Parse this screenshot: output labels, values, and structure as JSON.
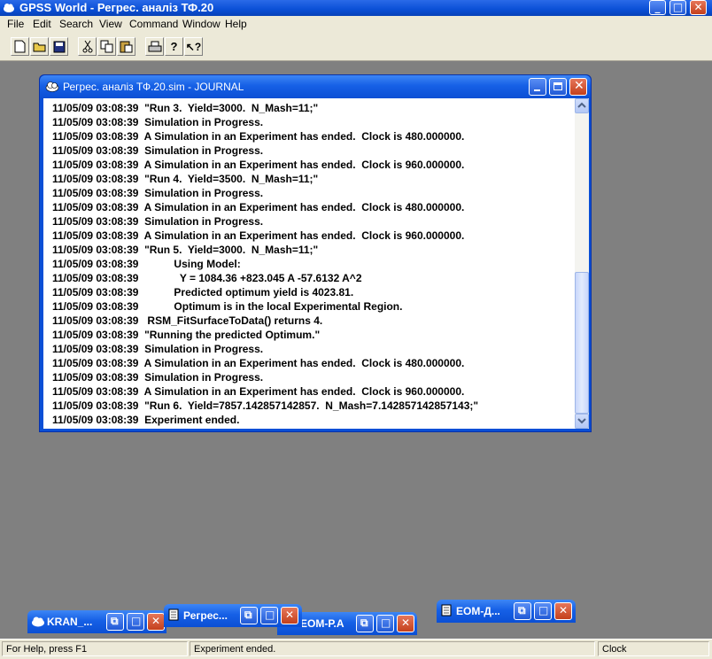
{
  "app": {
    "title": "GPSS World - Регрес. аналіз ТФ.20"
  },
  "menu": [
    {
      "label": "File"
    },
    {
      "label": "Edit"
    },
    {
      "label": "Search"
    },
    {
      "label": "View"
    },
    {
      "label": "Command"
    },
    {
      "label": "Window"
    },
    {
      "label": "Help"
    }
  ],
  "journal": {
    "title": "Регрес. аналіз ТФ.20.sim  -  JOURNAL",
    "lines": [
      "11/05/09 03:08:39  \"Run 3.  Yield=3000.  N_Mash=11;\"",
      "11/05/09 03:08:39  Simulation in Progress.",
      "11/05/09 03:08:39  A Simulation in an Experiment has ended.  Clock is 480.000000.",
      "11/05/09 03:08:39  Simulation in Progress.",
      "11/05/09 03:08:39  A Simulation in an Experiment has ended.  Clock is 960.000000.",
      "11/05/09 03:08:39  \"Run 4.  Yield=3500.  N_Mash=11;\"",
      "11/05/09 03:08:39  Simulation in Progress.",
      "11/05/09 03:08:39  A Simulation in an Experiment has ended.  Clock is 480.000000.",
      "11/05/09 03:08:39  Simulation in Progress.",
      "11/05/09 03:08:39  A Simulation in an Experiment has ended.  Clock is 960.000000.",
      "11/05/09 03:08:39  \"Run 5.  Yield=3000.  N_Mash=11;\"",
      "11/05/09 03:08:39            Using Model:",
      "11/05/09 03:08:39              Y = 1084.36 +823.045 A -57.6132 A^2",
      "11/05/09 03:08:39            Predicted optimum yield is 4023.81.",
      "11/05/09 03:08:39            Optimum is in the local Experimental Region.",
      "11/05/09 03:08:39   RSM_FitSurfaceToData() returns 4.",
      "11/05/09 03:08:39  \"Running the predicted Optimum.\"",
      "11/05/09 03:08:39  Simulation in Progress.",
      "11/05/09 03:08:39  A Simulation in an Experiment has ended.  Clock is 480.000000.",
      "11/05/09 03:08:39  Simulation in Progress.",
      "11/05/09 03:08:39  A Simulation in an Experiment has ended.  Clock is 960.000000.",
      "11/05/09 03:08:39  \"Run 6.  Yield=7857.142857142857.  N_Mash=7.142857142857143;\"",
      "11/05/09 03:08:39  Experiment ended."
    ]
  },
  "minimized": [
    {
      "title": "KRAN_..."
    },
    {
      "title": "Регрес..."
    },
    {
      "title": "ЕОМ-Р.А"
    },
    {
      "title": "ЕОМ-Д..."
    }
  ],
  "status": {
    "help": "For Help, press F1",
    "message": "Experiment ended.",
    "clock_label": "Clock"
  }
}
